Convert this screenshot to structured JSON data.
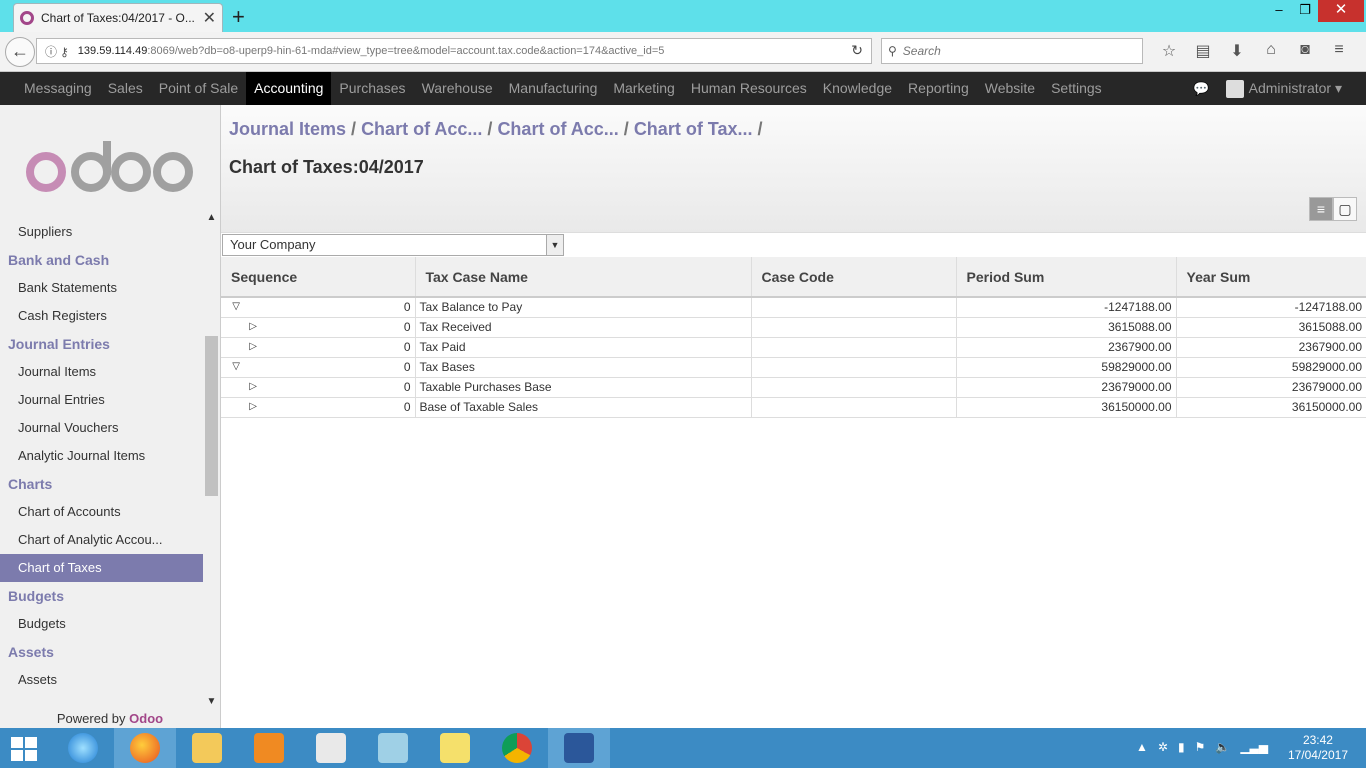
{
  "browser": {
    "tab_title": "Chart of Taxes:04/2017 - O...",
    "url_host": "139.59.114.49",
    "url_rest": ":8069/web?db=o8-uperp9-hin-61-mda#view_type=tree&model=account.tax.code&action=174&active_id=5",
    "search_placeholder": "Search"
  },
  "topmenu": {
    "items": [
      "Messaging",
      "Sales",
      "Point of Sale",
      "Accounting",
      "Purchases",
      "Warehouse",
      "Manufacturing",
      "Marketing",
      "Human Resources",
      "Knowledge",
      "Reporting",
      "Website",
      "Settings"
    ],
    "active": "Accounting",
    "user": "Administrator"
  },
  "sidebar": {
    "entries": [
      {
        "type": "item",
        "label": "Suppliers"
      },
      {
        "type": "head",
        "label": "Bank and Cash"
      },
      {
        "type": "item",
        "label": "Bank Statements"
      },
      {
        "type": "item",
        "label": "Cash Registers"
      },
      {
        "type": "head",
        "label": "Journal Entries"
      },
      {
        "type": "item",
        "label": "Journal Items"
      },
      {
        "type": "item",
        "label": "Journal Entries"
      },
      {
        "type": "item",
        "label": "Journal Vouchers"
      },
      {
        "type": "item",
        "label": "Analytic Journal Items"
      },
      {
        "type": "head",
        "label": "Charts"
      },
      {
        "type": "item",
        "label": "Chart of Accounts"
      },
      {
        "type": "item",
        "label": "Chart of Analytic Accou..."
      },
      {
        "type": "item",
        "label": "Chart of Taxes",
        "active": true
      },
      {
        "type": "head",
        "label": "Budgets"
      },
      {
        "type": "item",
        "label": "Budgets"
      },
      {
        "type": "head",
        "label": "Assets"
      },
      {
        "type": "item",
        "label": "Assets"
      }
    ],
    "powered_prefix": "Powered by",
    "powered_brand": "Odoo"
  },
  "main": {
    "breadcrumbs": [
      "Journal Items",
      "Chart of Acc...",
      "Chart of Acc...",
      "Chart of Tax..."
    ],
    "title": "Chart of Taxes:04/2017",
    "company": "Your Company",
    "columns": [
      "Sequence",
      "Tax Case Name",
      "Case Code",
      "Period Sum",
      "Year Sum"
    ],
    "rows": [
      {
        "level": 0,
        "expanded": true,
        "sequence": "0",
        "name": "Tax Balance to Pay",
        "code": "",
        "period": "-1247188.00",
        "year": "-1247188.00"
      },
      {
        "level": 1,
        "expanded": false,
        "sequence": "0",
        "name": "Tax Received",
        "code": "",
        "period": "3615088.00",
        "year": "3615088.00"
      },
      {
        "level": 1,
        "expanded": false,
        "sequence": "0",
        "name": "Tax Paid",
        "code": "",
        "period": "2367900.00",
        "year": "2367900.00"
      },
      {
        "level": 0,
        "expanded": true,
        "sequence": "0",
        "name": "Tax Bases",
        "code": "",
        "period": "59829000.00",
        "year": "59829000.00"
      },
      {
        "level": 1,
        "expanded": false,
        "sequence": "0",
        "name": "Taxable Purchases Base",
        "code": "",
        "period": "23679000.00",
        "year": "23679000.00"
      },
      {
        "level": 1,
        "expanded": false,
        "sequence": "0",
        "name": "Base of Taxable Sales",
        "code": "",
        "period": "36150000.00",
        "year": "36150000.00"
      }
    ]
  },
  "taskbar": {
    "time": "23:42",
    "date": "17/04/2017"
  },
  "colors": {
    "accent": "#7c7bad",
    "brand": "#a24689",
    "topmenu_bg": "#272727"
  }
}
